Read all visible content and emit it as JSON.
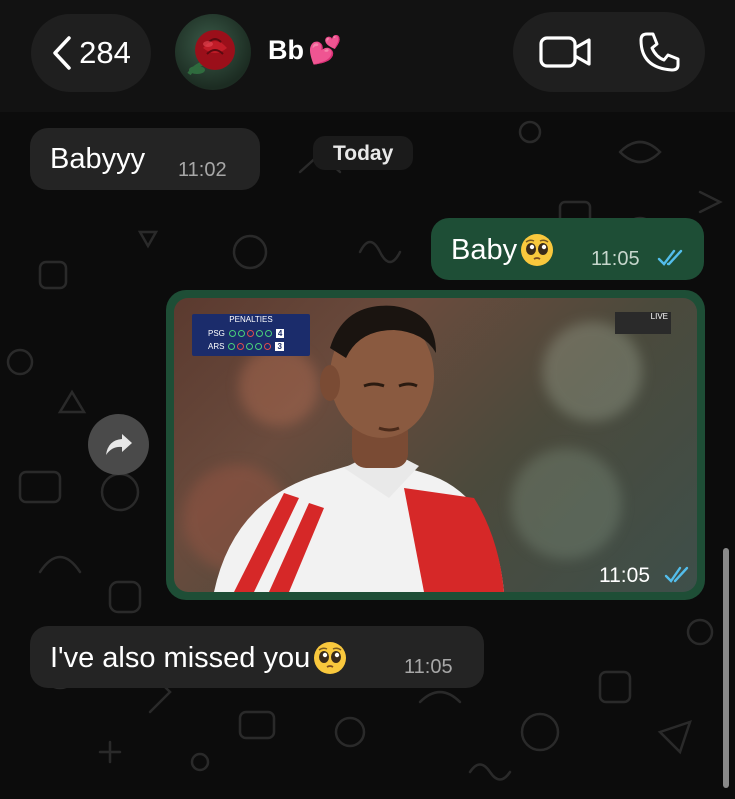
{
  "header": {
    "back_count": "284",
    "contact_name": "Bb",
    "contact_emoji": "💕",
    "avatar_icon": "red-rose",
    "icons": [
      "chevron-left-icon",
      "video-call-icon",
      "phone-call-icon"
    ]
  },
  "date_separator": "Today",
  "messages": [
    {
      "direction": "incoming",
      "text": "Babyyy",
      "time": "11:02"
    },
    {
      "direction": "outgoing",
      "text": "Baby",
      "emoji": "pleading-face",
      "time": "11:05",
      "status": "read"
    },
    {
      "direction": "outgoing",
      "type": "video",
      "time": "11:05",
      "status": "read",
      "thumbnail": {
        "scoreboard_title": "PENALTIES",
        "team1": "PSG",
        "team1_score": "4",
        "team2": "ARS",
        "team2_score": "3",
        "live_label": "LIVE"
      }
    },
    {
      "direction": "incoming",
      "text": "I've also missed you",
      "emoji": "pleading-face",
      "time": "11:05"
    }
  ],
  "colors": {
    "outgoing_bubble": "#1e4e36",
    "incoming_bubble": "#242424",
    "read_ticks": "#53bdeb"
  }
}
